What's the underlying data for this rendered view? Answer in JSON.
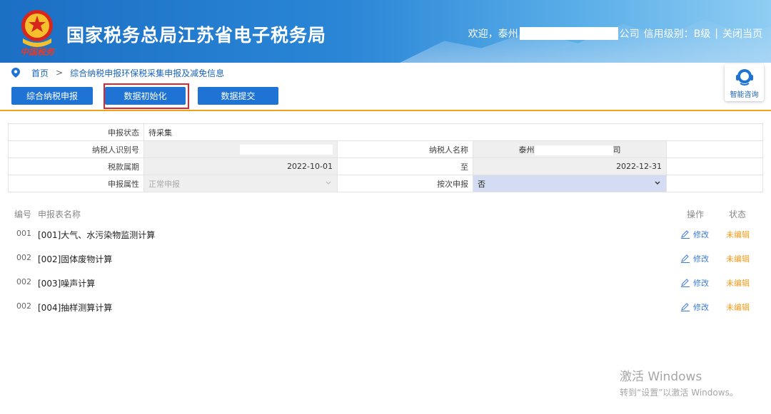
{
  "header": {
    "site_title": "国家税务总局江苏省电子税务局",
    "emblem_script": "中国税务",
    "welcome_prefix": "欢迎，泰州",
    "welcome_suffix": "公司",
    "credit_level": "信用级别：B级",
    "separator": "|",
    "close_link": "关闭当页"
  },
  "breadcrumb": {
    "home": "首页",
    "separator": ">",
    "current": "综合纳税申报环保税采集申报及减免信息"
  },
  "toolbar": {
    "buttons": [
      "综合纳税申报",
      "数据初始化",
      "数据提交"
    ]
  },
  "consult": {
    "label": "智能咨询"
  },
  "form": {
    "status_label": "申报状态",
    "status_value": "待采集",
    "taxpayer_id_label": "纳税人识别号",
    "taxpayer_name_label": "纳税人名称",
    "taxpayer_name_prefix": "泰州",
    "taxpayer_name_suffix": "司",
    "period_label": "税款属期",
    "period_start": "2022-10-01",
    "period_to": "至",
    "period_end": "2022-12-31",
    "attr_label": "申报属性",
    "attr_value": "正常申报",
    "per_time_label": "按次申报",
    "per_time_value": "否"
  },
  "list": {
    "headers": {
      "no": "编号",
      "name": "申报表名称",
      "op": "操作",
      "status": "状态"
    },
    "rows": [
      {
        "no": "001",
        "name": "[001]大气、水污染物监测计算",
        "op": "修改",
        "status": "未编辑"
      },
      {
        "no": "002",
        "name": "[002]固体废物计算",
        "op": "修改",
        "status": "未编辑"
      },
      {
        "no": "002",
        "name": "[003]噪声计算",
        "op": "修改",
        "status": "未编辑"
      },
      {
        "no": "002",
        "name": "[004]抽样测算计算",
        "op": "修改",
        "status": "未编辑"
      }
    ]
  },
  "watermark": {
    "line1": "激活 Windows",
    "line2": "转到“设置”以激活 Windows。"
  },
  "colors": {
    "header_blue": "#1b6fc4",
    "button_blue": "#1e73d4",
    "highlight_red": "#e0242b",
    "divider_orange": "#f1a21a",
    "status_orange": "#f19a1a",
    "link_blue": "#3b7ad9"
  }
}
